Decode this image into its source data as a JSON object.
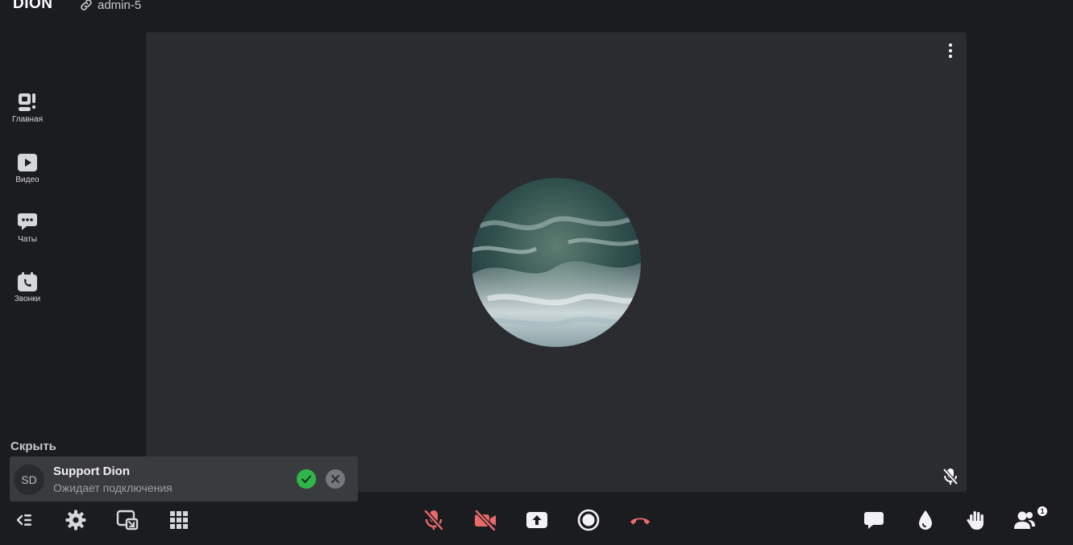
{
  "header": {
    "logo": "DION",
    "room_link": "admin-5"
  },
  "sidebar": {
    "items": [
      {
        "label": "Главная",
        "icon": "home-camera-icon"
      },
      {
        "label": "Видео",
        "icon": "video-play-icon"
      },
      {
        "label": "Чаты",
        "icon": "chat-bubble-icon"
      },
      {
        "label": "Звонки",
        "icon": "calendar-call-icon"
      }
    ],
    "hide_label": "Скрыть"
  },
  "notification": {
    "avatar_initials": "SD",
    "name": "Support Dion",
    "status": "Ожидает подключения"
  },
  "toolbar": {
    "participants_count": "1"
  },
  "colors": {
    "background": "#1b1c1f",
    "stage": "#2b2c30",
    "muted_red": "#e86a6a",
    "accept_green": "#2fb64a"
  }
}
